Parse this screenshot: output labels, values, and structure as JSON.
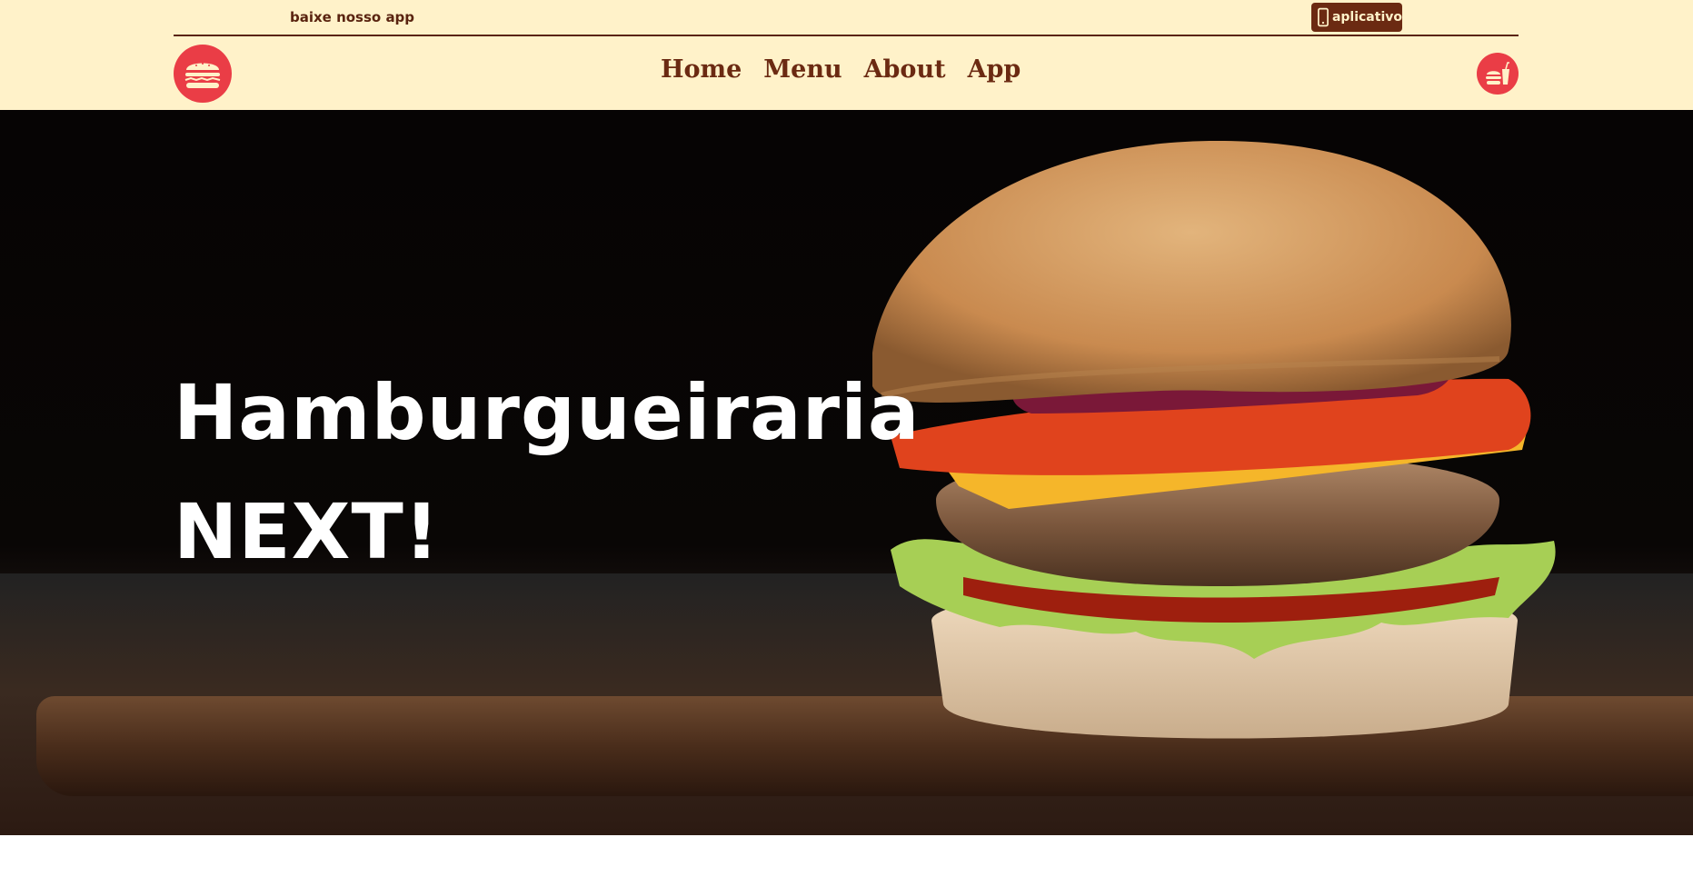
{
  "header": {
    "app_text": "baixe nosso app",
    "app_button_label": "aplicativo",
    "nav": [
      "Home",
      "Menu",
      "About",
      "App"
    ]
  },
  "hero": {
    "title_line1": "Hamburgueiraria",
    "title_line2": "NEXT!"
  },
  "icons": {
    "logo": "burger-icon",
    "app_button": "smartphone-icon",
    "cart": "fastfood-icon"
  },
  "colors": {
    "header_bg": "#fff2c9",
    "brand_brown": "#6b2a12",
    "accent_red": "#ea3d46"
  }
}
